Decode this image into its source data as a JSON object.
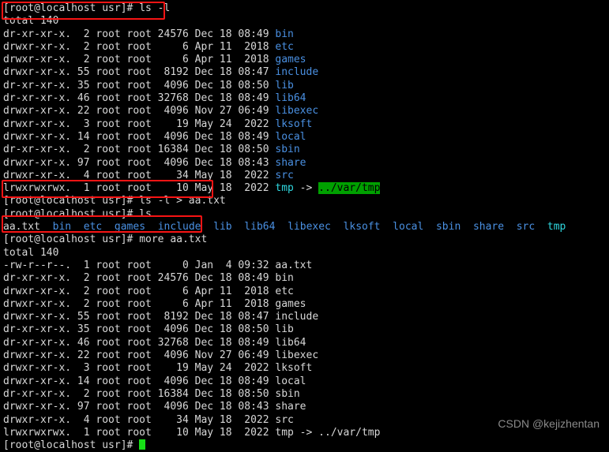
{
  "terminal": {
    "prompt": "[root@localhost usr]# ",
    "cursor_color": "#16e016",
    "background": "#000000",
    "foreground": "#d8d8d8",
    "dir_color": "#4a90e2",
    "link_color": "#2fd8e0",
    "link_target_bg": "#00a000",
    "annotation_color": "#f71414",
    "commands": {
      "cmd1": "ls -l",
      "cmd2": "ls -l > aa.txt",
      "cmd3": "ls",
      "cmd4": "more aa.txt"
    },
    "block1": {
      "total": "total 140",
      "rows": [
        {
          "perms": "dr-xr-xr-x.",
          "links": "2",
          "owner": "root",
          "group": "root",
          "size": "24576",
          "month": "Dec",
          "day": "18",
          "time": "08:49",
          "name": "bin",
          "type": "dir"
        },
        {
          "perms": "drwxr-xr-x.",
          "links": "2",
          "owner": "root",
          "group": "root",
          "size": "6",
          "month": "Apr",
          "day": "11",
          "time": "2018",
          "name": "etc",
          "type": "dir"
        },
        {
          "perms": "drwxr-xr-x.",
          "links": "2",
          "owner": "root",
          "group": "root",
          "size": "6",
          "month": "Apr",
          "day": "11",
          "time": "2018",
          "name": "games",
          "type": "dir"
        },
        {
          "perms": "drwxr-xr-x.",
          "links": "55",
          "owner": "root",
          "group": "root",
          "size": "8192",
          "month": "Dec",
          "day": "18",
          "time": "08:47",
          "name": "include",
          "type": "dir"
        },
        {
          "perms": "dr-xr-xr-x.",
          "links": "35",
          "owner": "root",
          "group": "root",
          "size": "4096",
          "month": "Dec",
          "day": "18",
          "time": "08:50",
          "name": "lib",
          "type": "dir"
        },
        {
          "perms": "dr-xr-xr-x.",
          "links": "46",
          "owner": "root",
          "group": "root",
          "size": "32768",
          "month": "Dec",
          "day": "18",
          "time": "08:49",
          "name": "lib64",
          "type": "dir"
        },
        {
          "perms": "drwxr-xr-x.",
          "links": "22",
          "owner": "root",
          "group": "root",
          "size": "4096",
          "month": "Nov",
          "day": "27",
          "time": "06:49",
          "name": "libexec",
          "type": "dir"
        },
        {
          "perms": "drwxr-xr-x.",
          "links": "3",
          "owner": "root",
          "group": "root",
          "size": "19",
          "month": "May",
          "day": "24",
          "time": "2022",
          "name": "lksoft",
          "type": "dir"
        },
        {
          "perms": "drwxr-xr-x.",
          "links": "14",
          "owner": "root",
          "group": "root",
          "size": "4096",
          "month": "Dec",
          "day": "18",
          "time": "08:49",
          "name": "local",
          "type": "dir"
        },
        {
          "perms": "dr-xr-xr-x.",
          "links": "2",
          "owner": "root",
          "group": "root",
          "size": "16384",
          "month": "Dec",
          "day": "18",
          "time": "08:50",
          "name": "sbin",
          "type": "dir"
        },
        {
          "perms": "drwxr-xr-x.",
          "links": "97",
          "owner": "root",
          "group": "root",
          "size": "4096",
          "month": "Dec",
          "day": "18",
          "time": "08:43",
          "name": "share",
          "type": "dir"
        },
        {
          "perms": "drwxr-xr-x.",
          "links": "4",
          "owner": "root",
          "group": "root",
          "size": "34",
          "month": "May",
          "day": "18",
          "time": "2022",
          "name": "src",
          "type": "dir"
        },
        {
          "perms": "lrwxrwxrwx.",
          "links": "1",
          "owner": "root",
          "group": "root",
          "size": "10",
          "month": "May",
          "day": "18",
          "time": "2022",
          "name": "tmp",
          "type": "link",
          "arrow": " -> ",
          "target": "../var/tmp"
        }
      ]
    },
    "ls_short": {
      "entries": [
        {
          "name": "aa.txt",
          "type": "file"
        },
        {
          "name": "bin",
          "type": "dir"
        },
        {
          "name": "etc",
          "type": "dir"
        },
        {
          "name": "games",
          "type": "dir"
        },
        {
          "name": "include",
          "type": "dir"
        },
        {
          "name": "lib",
          "type": "dir"
        },
        {
          "name": "lib64",
          "type": "dir"
        },
        {
          "name": "libexec",
          "type": "dir"
        },
        {
          "name": "lksoft",
          "type": "dir"
        },
        {
          "name": "local",
          "type": "dir"
        },
        {
          "name": "sbin",
          "type": "dir"
        },
        {
          "name": "share",
          "type": "dir"
        },
        {
          "name": "src",
          "type": "dir"
        },
        {
          "name": "tmp",
          "type": "link"
        }
      ]
    },
    "block2": {
      "total": "total 140",
      "rows": [
        {
          "perms": "-rw-r--r--.",
          "links": "1",
          "owner": "root",
          "group": "root",
          "size": "0",
          "month": "Jan",
          "day": "4",
          "time": "09:32",
          "name": "aa.txt"
        },
        {
          "perms": "dr-xr-xr-x.",
          "links": "2",
          "owner": "root",
          "group": "root",
          "size": "24576",
          "month": "Dec",
          "day": "18",
          "time": "08:49",
          "name": "bin"
        },
        {
          "perms": "drwxr-xr-x.",
          "links": "2",
          "owner": "root",
          "group": "root",
          "size": "6",
          "month": "Apr",
          "day": "11",
          "time": "2018",
          "name": "etc"
        },
        {
          "perms": "drwxr-xr-x.",
          "links": "2",
          "owner": "root",
          "group": "root",
          "size": "6",
          "month": "Apr",
          "day": "11",
          "time": "2018",
          "name": "games"
        },
        {
          "perms": "drwxr-xr-x.",
          "links": "55",
          "owner": "root",
          "group": "root",
          "size": "8192",
          "month": "Dec",
          "day": "18",
          "time": "08:47",
          "name": "include"
        },
        {
          "perms": "dr-xr-xr-x.",
          "links": "35",
          "owner": "root",
          "group": "root",
          "size": "4096",
          "month": "Dec",
          "day": "18",
          "time": "08:50",
          "name": "lib"
        },
        {
          "perms": "dr-xr-xr-x.",
          "links": "46",
          "owner": "root",
          "group": "root",
          "size": "32768",
          "month": "Dec",
          "day": "18",
          "time": "08:49",
          "name": "lib64"
        },
        {
          "perms": "drwxr-xr-x.",
          "links": "22",
          "owner": "root",
          "group": "root",
          "size": "4096",
          "month": "Nov",
          "day": "27",
          "time": "06:49",
          "name": "libexec"
        },
        {
          "perms": "drwxr-xr-x.",
          "links": "3",
          "owner": "root",
          "group": "root",
          "size": "19",
          "month": "May",
          "day": "24",
          "time": "2022",
          "name": "lksoft"
        },
        {
          "perms": "drwxr-xr-x.",
          "links": "14",
          "owner": "root",
          "group": "root",
          "size": "4096",
          "month": "Dec",
          "day": "18",
          "time": "08:49",
          "name": "local"
        },
        {
          "perms": "dr-xr-xr-x.",
          "links": "2",
          "owner": "root",
          "group": "root",
          "size": "16384",
          "month": "Dec",
          "day": "18",
          "time": "08:50",
          "name": "sbin"
        },
        {
          "perms": "drwxr-xr-x.",
          "links": "97",
          "owner": "root",
          "group": "root",
          "size": "4096",
          "month": "Dec",
          "day": "18",
          "time": "08:43",
          "name": "share"
        },
        {
          "perms": "drwxr-xr-x.",
          "links": "4",
          "owner": "root",
          "group": "root",
          "size": "34",
          "month": "May",
          "day": "18",
          "time": "2022",
          "name": "src"
        },
        {
          "perms": "lrwxrwxrwx.",
          "links": "1",
          "owner": "root",
          "group": "root",
          "size": "10",
          "month": "May",
          "day": "18",
          "time": "2022",
          "name": "tmp -> ../var/tmp"
        }
      ]
    }
  },
  "watermark": {
    "text": "CSDN @kejizhentan"
  }
}
